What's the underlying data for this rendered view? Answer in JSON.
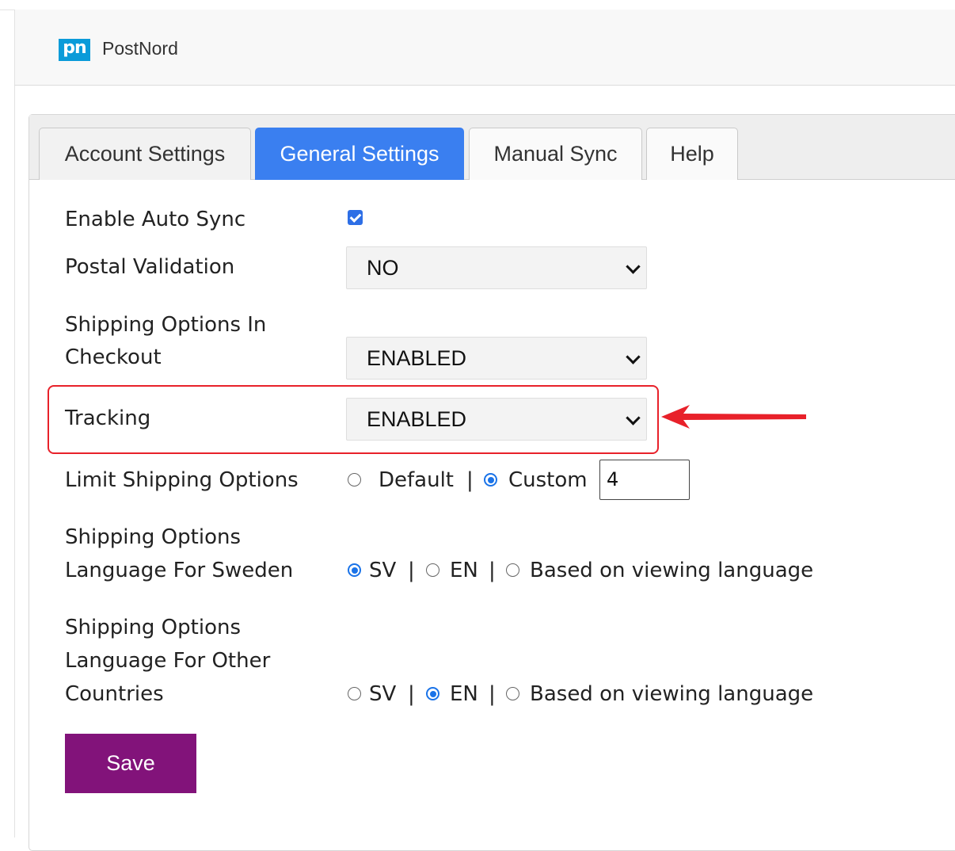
{
  "header": {
    "logo_text": "pn",
    "brand": "PostNord",
    "logo_color": "#0a9bd9"
  },
  "tabs": [
    {
      "label": "Account Settings",
      "active": false
    },
    {
      "label": "General Settings",
      "active": true
    },
    {
      "label": "Manual Sync",
      "active": false
    },
    {
      "label": "Help",
      "active": false
    }
  ],
  "settings": {
    "auto_sync": {
      "label": "Enable Auto Sync",
      "checked": true
    },
    "postal_validation": {
      "label": "Postal Validation",
      "value": "NO"
    },
    "shipping_checkout": {
      "label_line1": "Shipping Options In",
      "label_line2": "Checkout",
      "value": "ENABLED"
    },
    "tracking": {
      "label": "Tracking",
      "value": "ENABLED"
    },
    "limit_shipping": {
      "label": "Limit Shipping Options",
      "option_default": "Default",
      "option_custom": "Custom",
      "separator": "|",
      "selected": "Custom",
      "custom_value": "4"
    },
    "lang_sweden": {
      "label_line1": "Shipping Options",
      "label_line2": "Language For Sweden",
      "options": [
        "SV",
        "EN",
        "Based on viewing language"
      ],
      "selected": "SV"
    },
    "lang_other": {
      "label_line1": "Shipping Options",
      "label_line2": "Language For Other",
      "label_line3": "Countries",
      "options": [
        "SV",
        "EN",
        "Based on viewing language"
      ],
      "selected": "EN"
    }
  },
  "save_label": "Save",
  "colors": {
    "active_tab": "#3a7ff0",
    "save_button": "#82137a",
    "highlight": "#e8212a"
  },
  "annotation": {
    "type": "red highlight box with arrow pointing to Tracking"
  }
}
